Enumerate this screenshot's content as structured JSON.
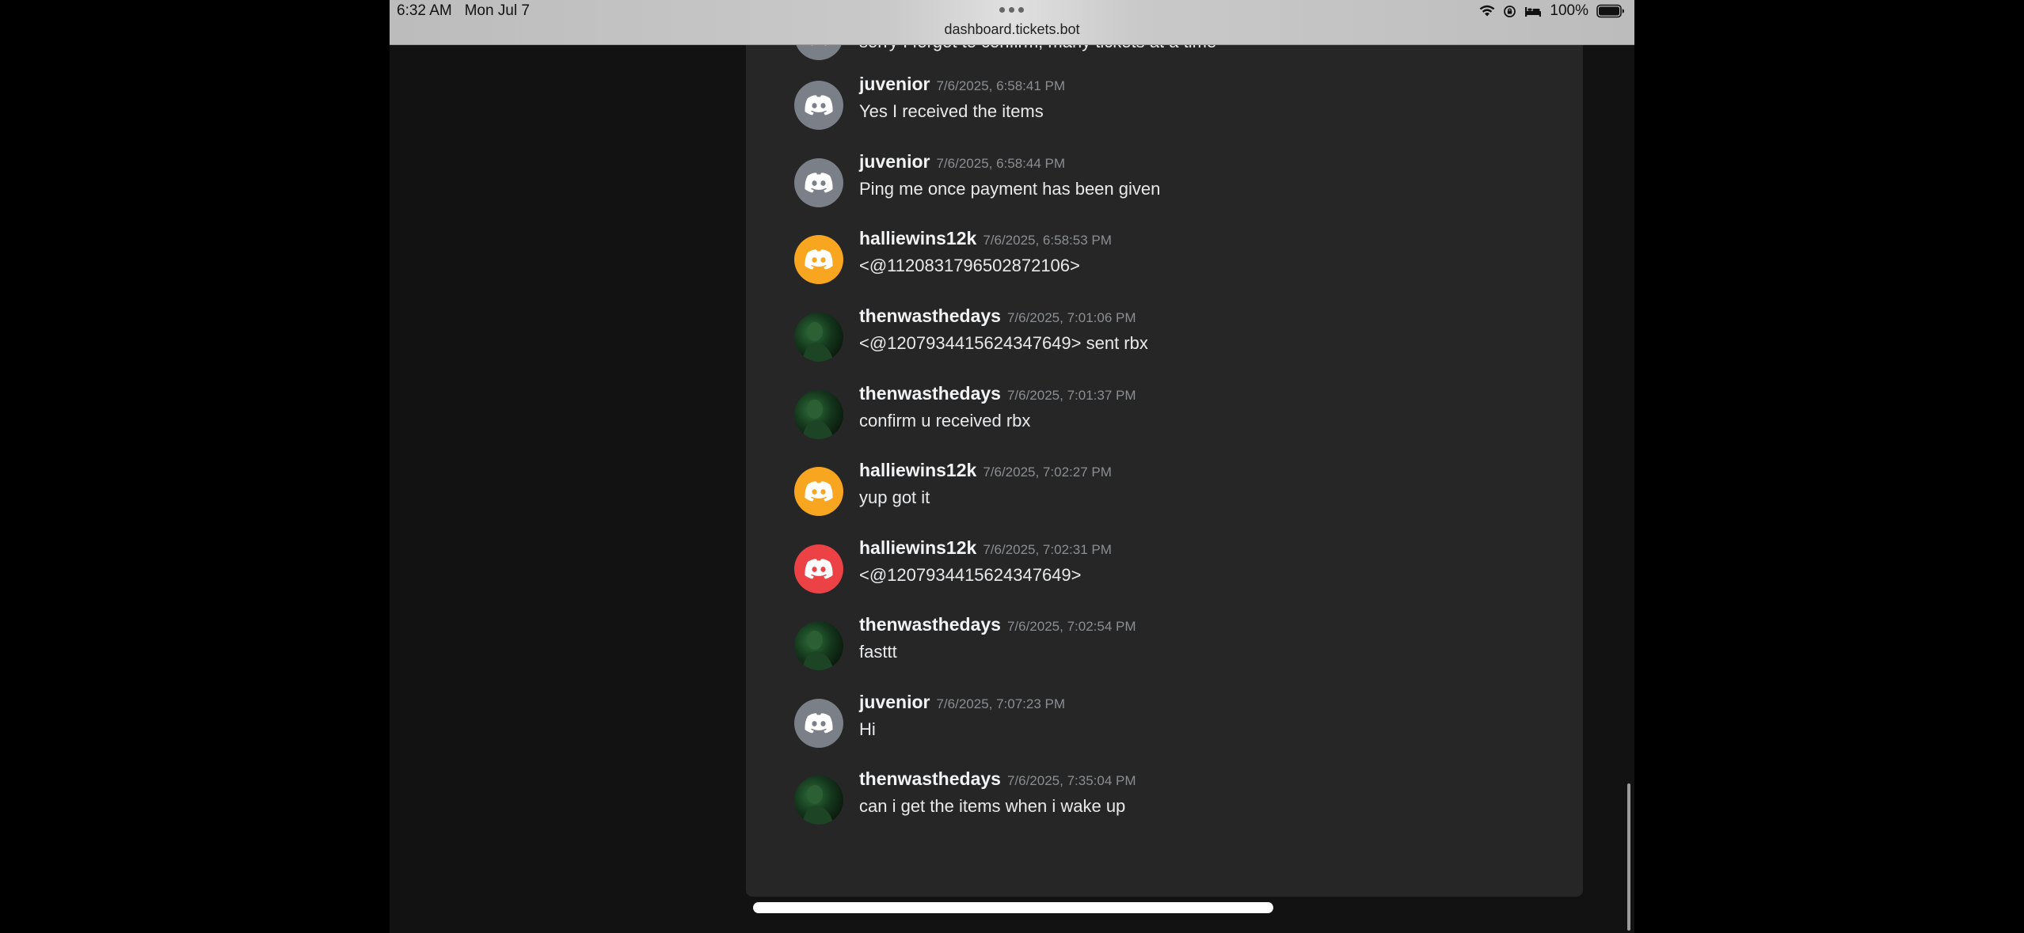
{
  "status": {
    "time": "6:32 AM",
    "date": "Mon Jul 7",
    "battery": "100%",
    "url": "dashboard.tickets.bot"
  },
  "icons": {
    "wifi": "wifi-icon",
    "lock_rotation": "orientation-lock-icon",
    "sleep": "bed-icon",
    "battery": "battery-icon",
    "discord": "discord-icon"
  },
  "colors": {
    "panel": "#262626",
    "avatar_gray": "#7a7f88",
    "avatar_orange": "#f8a61f",
    "avatar_red": "#ed4245"
  },
  "messages": [
    {
      "author": "",
      "timestamp": "",
      "text": "sorry I forgot to confirm, many tickets at a time",
      "avatar": "gray"
    },
    {
      "author": "juvenior",
      "timestamp": "7/6/2025, 6:58:41 PM",
      "text": "Yes I received the items",
      "avatar": "gray"
    },
    {
      "author": "juvenior",
      "timestamp": "7/6/2025, 6:58:44 PM",
      "text": "Ping me once payment has been given",
      "avatar": "gray"
    },
    {
      "author": "halliewins12k",
      "timestamp": "7/6/2025, 6:58:53 PM",
      "text": "<@1120831796502872106>",
      "avatar": "orange"
    },
    {
      "author": "thenwasthedays",
      "timestamp": "7/6/2025, 7:01:06 PM",
      "text": "<@1207934415624347649> sent rbx",
      "avatar": "photo"
    },
    {
      "author": "thenwasthedays",
      "timestamp": "7/6/2025, 7:01:37 PM",
      "text": "confirm u received rbx",
      "avatar": "photo"
    },
    {
      "author": "halliewins12k",
      "timestamp": "7/6/2025, 7:02:27 PM",
      "text": "yup got it",
      "avatar": "orange"
    },
    {
      "author": "halliewins12k",
      "timestamp": "7/6/2025, 7:02:31 PM",
      "text": "<@1207934415624347649>",
      "avatar": "red"
    },
    {
      "author": "thenwasthedays",
      "timestamp": "7/6/2025, 7:02:54 PM",
      "text": "fasttt",
      "avatar": "photo"
    },
    {
      "author": "juvenior",
      "timestamp": "7/6/2025, 7:07:23 PM",
      "text": "Hi",
      "avatar": "gray"
    },
    {
      "author": "thenwasthedays",
      "timestamp": "7/6/2025, 7:35:04 PM",
      "text": "can i get the items when i wake up",
      "avatar": "photo"
    }
  ]
}
